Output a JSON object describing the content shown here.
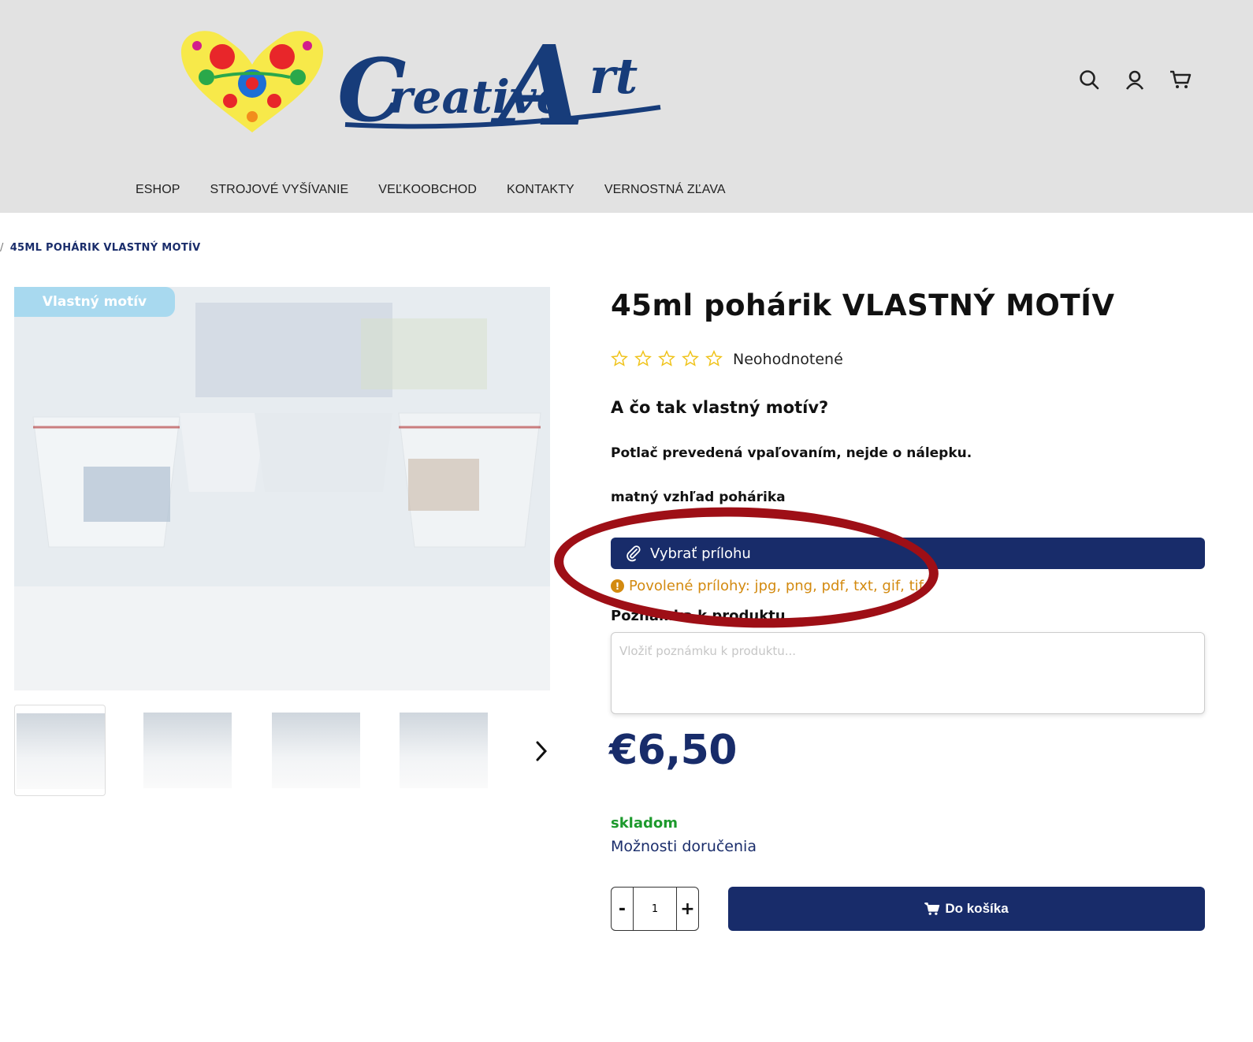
{
  "header": {
    "logo_text": "CreativeArt",
    "icons": [
      "search-icon",
      "user-icon",
      "cart-icon"
    ]
  },
  "nav": {
    "items": [
      "ESHOP",
      "STROJOVÉ VYŠÍVANIE",
      "VEĽKOOBCHOD",
      "KONTAKTY",
      "VERNOSTNÁ ZĽAVA"
    ]
  },
  "breadcrumb": {
    "sep": "/",
    "current": "45ML POHÁRIK VLASTNÝ MOTÍV"
  },
  "gallery": {
    "badge": "Vlastný motív",
    "thumbnail_count": 4
  },
  "product": {
    "title": "45ml pohárik VLASTNÝ MOTÍV",
    "rating_stars": 0,
    "rating_max": 5,
    "rating_text": "Neohodnotené",
    "subtitle": "A čo tak vlastný motív?",
    "desc1": "Potlač prevedená vpaľovaním, nejde o nálepku.",
    "desc2": "matný vzhľad pohárika",
    "attach_label": "Vybrať prílohu",
    "allowed_text": "Povolené prílohy: jpg, png, pdf, txt, gif, tif",
    "note_label": "Poznámka k produktu",
    "note_placeholder": "Vložiť poznámku k produktu...",
    "price": "€6,50",
    "stock": "skladom",
    "delivery": "Možnosti doručenia",
    "qty_minus": "-",
    "qty_value": "1",
    "qty_plus": "+",
    "cart_label": "Do košíka"
  },
  "colors": {
    "brand": "#182c6a",
    "badge": "#a8d9ef",
    "warning": "#d38a10",
    "stock": "#1d9a2d",
    "highlight_circle": "#9e0f16"
  }
}
